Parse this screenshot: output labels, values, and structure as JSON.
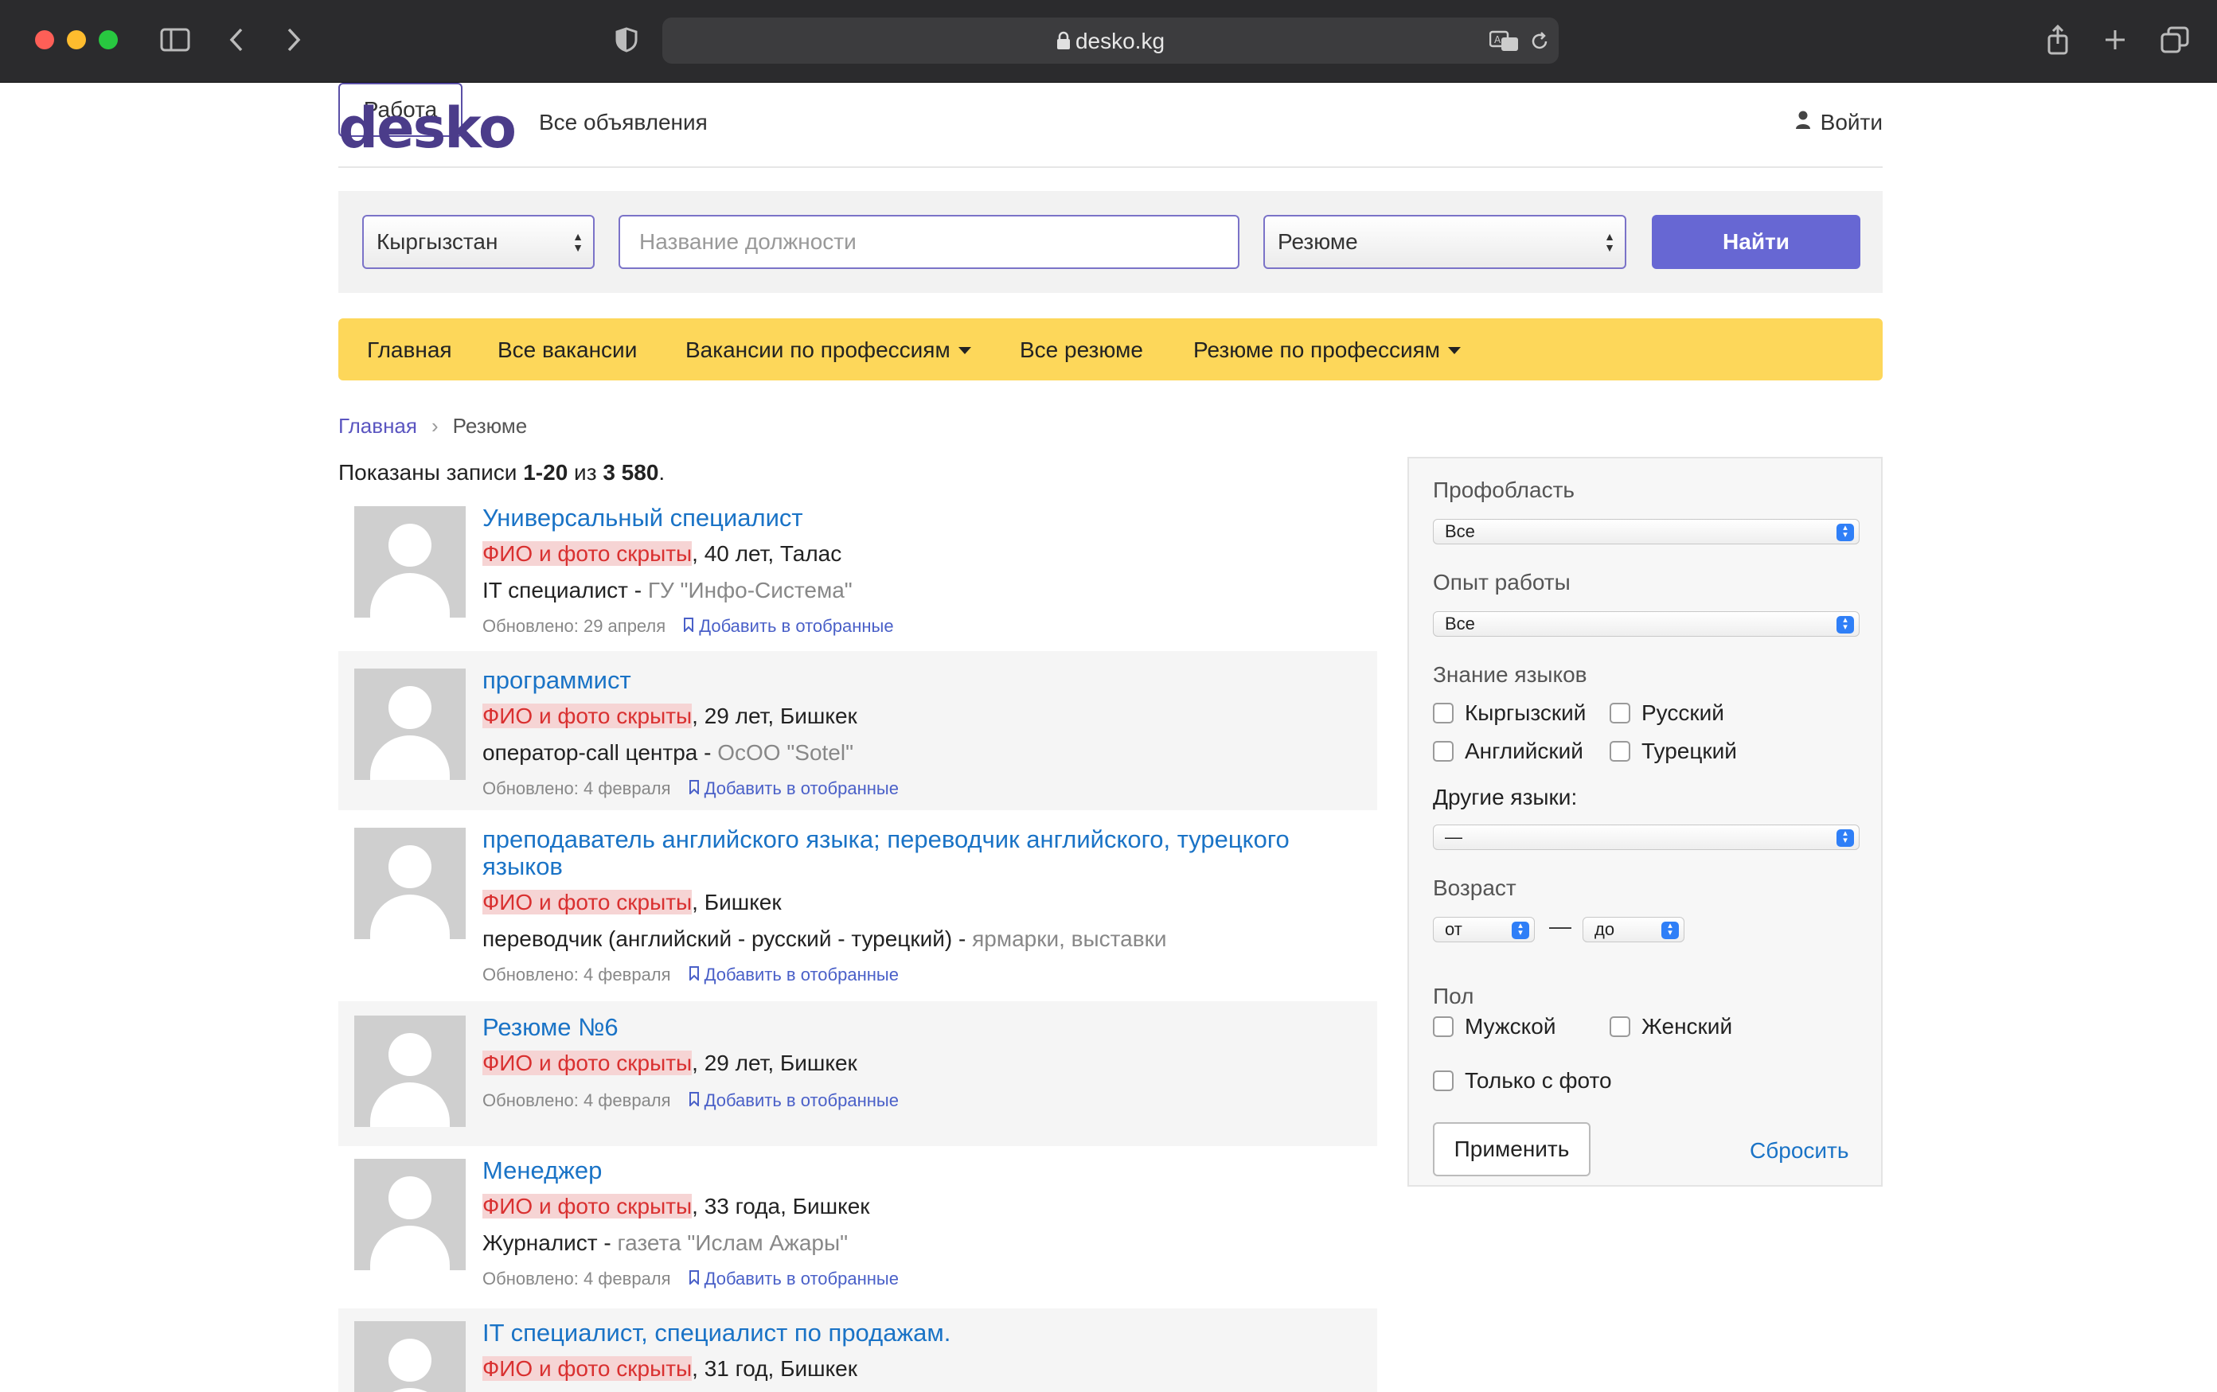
{
  "browser": {
    "url": "desko.kg"
  },
  "header": {
    "logo": "desko",
    "nav_all": "Все объявления",
    "nav_work": "Работа",
    "login": "Войти"
  },
  "search": {
    "country": "Кыргызстан",
    "title_placeholder": "Название должности",
    "type": "Резюме",
    "find_button": "Найти"
  },
  "menu": {
    "items": [
      "Главная",
      "Все вакансии",
      "Вакансии по профессиям",
      "Все резюме",
      "Резюме по профессиям"
    ]
  },
  "breadcrumb": {
    "home": "Главная",
    "separator": "›",
    "current": "Резюме"
  },
  "results": {
    "prefix": "Показаны записи ",
    "range": "1-20",
    "middle": " из ",
    "total": "3 580",
    "suffix": "."
  },
  "resumes": [
    {
      "title": "Универсальный специалист",
      "hidden": "ФИО и фото скрыты",
      "info": ", 40 лет, Талас",
      "position": "IT специалист - ",
      "company": "ГУ \"Инфо-Система\"",
      "updated": "Обновлено: 29 апреля",
      "fav": "Добавить в отобранные"
    },
    {
      "title": "программист",
      "hidden": "ФИО и фото скрыты",
      "info": ", 29 лет, Бишкек",
      "position": "оператор-call центра - ",
      "company": "ОсОО \"Sotel\"",
      "updated": "Обновлено: 4 февраля",
      "fav": "Добавить в отобранные"
    },
    {
      "title": "преподаватель английского языка; переводчик английского, турецкого языков",
      "hidden": "ФИО и фото скрыты",
      "info": ", Бишкек",
      "position": "переводчик (английский - русский - турецкий) - ",
      "company": "ярмарки, выставки",
      "updated": "Обновлено: 4 февраля",
      "fav": "Добавить в отобранные"
    },
    {
      "title": "Резюме №6",
      "hidden": "ФИО и фото скрыты",
      "info": ", 29 лет, Бишкек",
      "updated": "Обновлено: 4 февраля",
      "fav": "Добавить в отобранные"
    },
    {
      "title": "Менеджер",
      "hidden": "ФИО и фото скрыты",
      "info": ", 33 года, Бишкек",
      "position": "Журналист - ",
      "company": "газета \"Ислам Ажары\"",
      "updated": "Обновлено: 4 февраля",
      "fav": "Добавить в отобранные"
    },
    {
      "title": "IT специалист, специалист по продажам.",
      "hidden": "ФИО и фото скрыты",
      "info": ", 31 год, Бишкек"
    }
  ],
  "filters": {
    "prof_label": "Профобласть",
    "prof_value": "Все",
    "exp_label": "Опыт работы",
    "exp_value": "Все",
    "lang_label": "Знание языков",
    "langs": [
      "Кыргызский",
      "Русский",
      "Английский",
      "Турецкий"
    ],
    "other_lang_label": "Другие языки:",
    "other_lang_value": "—",
    "age_label": "Возраст",
    "age_from": "от",
    "age_dash": "—",
    "age_to": "до",
    "gender_label": "Пол",
    "genders": [
      "Мужской",
      "Женский"
    ],
    "photo_only": "Только с фото",
    "apply": "Применить",
    "reset": "Сбросить"
  }
}
